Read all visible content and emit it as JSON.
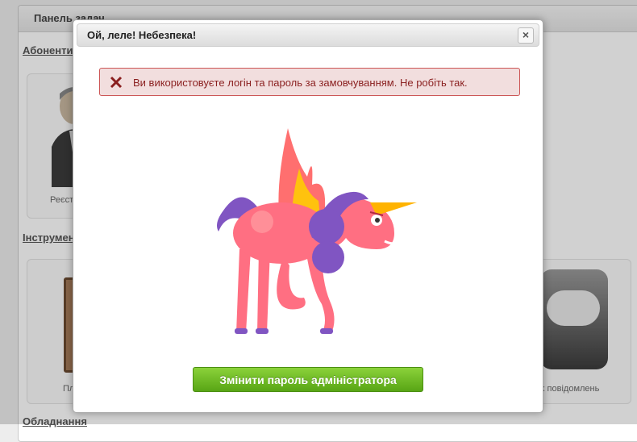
{
  "dashboard": {
    "title": "Панель задач",
    "sections": {
      "subscribers": "Абоненти",
      "tools": "Інструменти",
      "equipment": "Обладнання"
    },
    "tiles": {
      "registry_caption": "Реєст",
      "tool_caption": "Пл",
      "messages_caption": "вих повідомлень"
    }
  },
  "modal": {
    "title": "Ой, леле! Небезпека!",
    "close_label": "×",
    "alert_text": "Ви використовуєте логін та пароль за замовчуванням. Не робіть так.",
    "button_label": "Змінити пароль адміністратора"
  }
}
